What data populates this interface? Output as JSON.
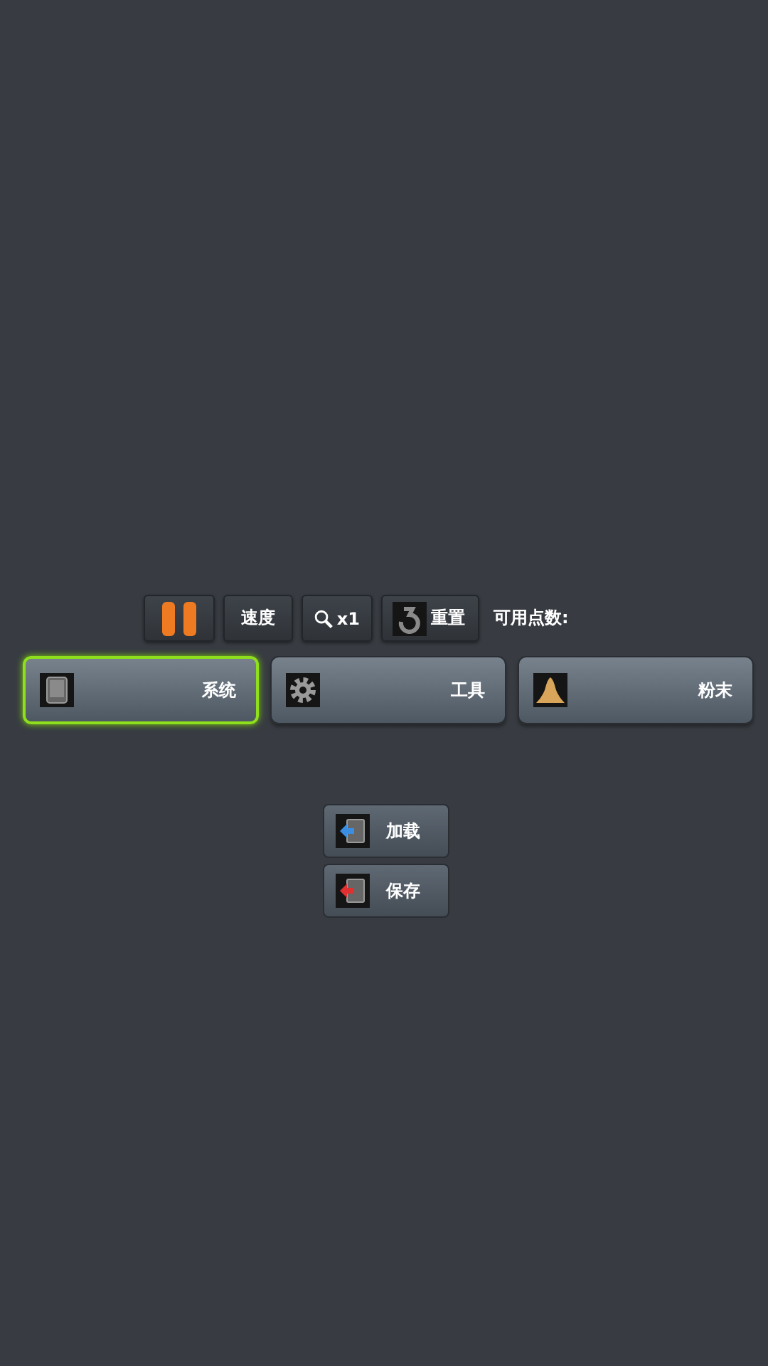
{
  "toolbar": [
    {
      "kind": "pause"
    },
    {
      "kind": "text",
      "label": "速度"
    },
    {
      "kind": "zoom",
      "label": "x1"
    },
    {
      "kind": "reset",
      "label": "重置"
    }
  ],
  "points_label": "可用点数:",
  "categories": [
    {
      "kind": "tablet",
      "label": "系统",
      "selected": true
    },
    {
      "kind": "gear",
      "label": "工具",
      "selected": false
    },
    {
      "kind": "powder",
      "label": "粉末",
      "selected": false
    }
  ],
  "actions": [
    {
      "kind": "load",
      "label": "加载"
    },
    {
      "kind": "save",
      "label": "保存"
    }
  ]
}
